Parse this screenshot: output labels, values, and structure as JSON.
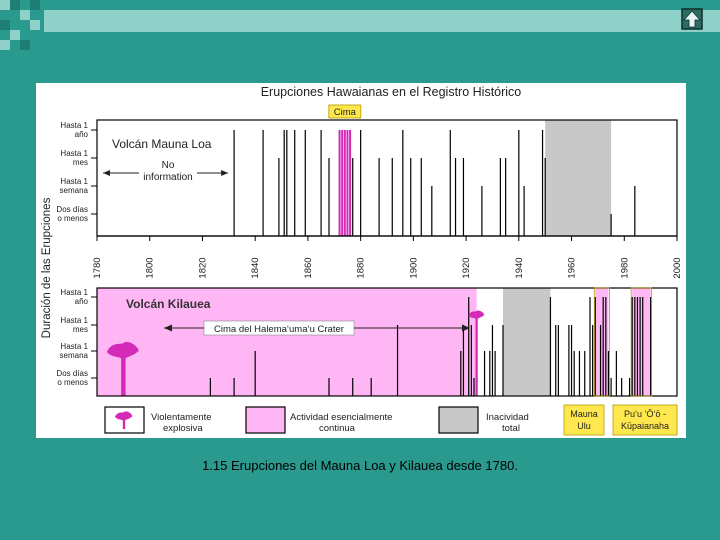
{
  "caption": "1.15  Erupciones del Mauna Loa y Kilauea desde 1780.",
  "colors": {
    "background": "#2a9a8e",
    "decor_light": "#8fd0c8",
    "decor_dark": "#1f7f75",
    "explosive": "#d42ab8",
    "continuous": "#ffb6f4",
    "inactive": "#c8c8c8",
    "event_line": "#000000"
  },
  "icons": {
    "nav": "home-arrow-icon",
    "plume": "eruption-plume-icon"
  },
  "chart_data": {
    "type": "timeline",
    "title": "Erupciones Hawaianas en el Registro Histórico",
    "ylabel": "Duración de las Erupciones",
    "xlim": [
      1780,
      2000
    ],
    "x_ticks": [
      "1780",
      "1800",
      "1820",
      "1840",
      "1860",
      "1880",
      "1900",
      "1920",
      "1940",
      "1960",
      "1980",
      "2000"
    ],
    "y_levels": [
      {
        "label": "Hasta 1 año",
        "rank": 4
      },
      {
        "label": "Hasta 1 mes",
        "rank": 3
      },
      {
        "label": "Hasta 1 semana",
        "rank": 2
      },
      {
        "label": "Dos días o menos",
        "rank": 1
      }
    ],
    "legend": [
      {
        "label": "Violentamente explosiva",
        "type": "explosive"
      },
      {
        "label": "Actividad esencialmente continua",
        "type": "continuous"
      },
      {
        "label": "Inacividad total",
        "type": "inactive"
      },
      {
        "label": "Mauna Ulu",
        "type": "marker"
      },
      {
        "label": "Pu‘u ‘Ō‘ō - Kūpaianaha",
        "type": "marker"
      }
    ],
    "panels": [
      {
        "name": "Volcán Mauna Loa",
        "annotations": [
          {
            "text": "No information",
            "x_start": 1780,
            "x_end": 1832
          },
          {
            "text": "Cima",
            "x_start": 1871,
            "x_end": 1877
          }
        ],
        "shaded": [
          {
            "type": "inactive",
            "start": 1950,
            "end": 1975
          }
        ],
        "eruptions": [
          {
            "year": 1832,
            "level": 4
          },
          {
            "year": 1843,
            "level": 4
          },
          {
            "year": 1849,
            "level": 3
          },
          {
            "year": 1851,
            "level": 4
          },
          {
            "year": 1852,
            "level": 4
          },
          {
            "year": 1855,
            "level": 4
          },
          {
            "year": 1859,
            "level": 4
          },
          {
            "year": 1865,
            "level": 4
          },
          {
            "year": 1868,
            "level": 3
          },
          {
            "year": 1872,
            "level": 4,
            "color": "explosive"
          },
          {
            "year": 1873,
            "level": 4,
            "color": "explosive"
          },
          {
            "year": 1874,
            "level": 4,
            "color": "explosive"
          },
          {
            "year": 1875,
            "level": 4,
            "color": "explosive"
          },
          {
            "year": 1876,
            "level": 4,
            "color": "explosive"
          },
          {
            "year": 1877,
            "level": 3
          },
          {
            "year": 1880,
            "level": 4
          },
          {
            "year": 1887,
            "level": 3
          },
          {
            "year": 1892,
            "level": 3
          },
          {
            "year": 1896,
            "level": 4
          },
          {
            "year": 1899,
            "level": 3
          },
          {
            "year": 1903,
            "level": 3
          },
          {
            "year": 1907,
            "level": 2
          },
          {
            "year": 1914,
            "level": 4
          },
          {
            "year": 1916,
            "level": 3
          },
          {
            "year": 1919,
            "level": 3
          },
          {
            "year": 1926,
            "level": 2
          },
          {
            "year": 1933,
            "level": 3
          },
          {
            "year": 1935,
            "level": 3
          },
          {
            "year": 1940,
            "level": 4
          },
          {
            "year": 1942,
            "level": 2
          },
          {
            "year": 1949,
            "level": 4
          },
          {
            "year": 1950,
            "level": 3
          },
          {
            "year": 1975,
            "level": 1
          },
          {
            "year": 1984,
            "level": 2
          }
        ]
      },
      {
        "name": "Volcán Kilauea",
        "annotations": [
          {
            "text": "Cima del Halema‘uma‘u Crater",
            "x_start": 1820,
            "x_end": 1924
          }
        ],
        "shaded": [
          {
            "type": "continuous",
            "start": 1780,
            "end": 1924
          },
          {
            "type": "inactive",
            "start": 1934,
            "end": 1952
          },
          {
            "type": "continuous",
            "start": 1969,
            "end": 1974
          },
          {
            "type": "continuous",
            "start": 1983,
            "end": 1990
          }
        ],
        "explosive_events": [
          1790,
          1924
        ],
        "eruptions": [
          {
            "year": 1823,
            "level": 1
          },
          {
            "year": 1832,
            "level": 1
          },
          {
            "year": 1840,
            "level": 2
          },
          {
            "year": 1868,
            "level": 1
          },
          {
            "year": 1877,
            "level": 1
          },
          {
            "year": 1884,
            "level": 1
          },
          {
            "year": 1894,
            "level": 3
          },
          {
            "year": 1918,
            "level": 2
          },
          {
            "year": 1919,
            "level": 3
          },
          {
            "year": 1921,
            "level": 4
          },
          {
            "year": 1922,
            "level": 3
          },
          {
            "year": 1923,
            "level": 1
          },
          {
            "year": 1924,
            "level": 3
          },
          {
            "year": 1927,
            "level": 2
          },
          {
            "year": 1929,
            "level": 2
          },
          {
            "year": 1930,
            "level": 3
          },
          {
            "year": 1931,
            "level": 2
          },
          {
            "year": 1934,
            "level": 3
          },
          {
            "year": 1952,
            "level": 4
          },
          {
            "year": 1954,
            "level": 3
          },
          {
            "year": 1955,
            "level": 3
          },
          {
            "year": 1959,
            "level": 3
          },
          {
            "year": 1960,
            "level": 3
          },
          {
            "year": 1961,
            "level": 2
          },
          {
            "year": 1963,
            "level": 2
          },
          {
            "year": 1965,
            "level": 2
          },
          {
            "year": 1967,
            "level": 4
          },
          {
            "year": 1968,
            "level": 3
          },
          {
            "year": 1969,
            "level": 4
          },
          {
            "year": 1971,
            "level": 3
          },
          {
            "year": 1972,
            "level": 4
          },
          {
            "year": 1973,
            "level": 4
          },
          {
            "year": 1974,
            "level": 2
          },
          {
            "year": 1975,
            "level": 1
          },
          {
            "year": 1977,
            "level": 2
          },
          {
            "year": 1979,
            "level": 1
          },
          {
            "year": 1982,
            "level": 1
          },
          {
            "year": 1983,
            "level": 4
          },
          {
            "year": 1984,
            "level": 4
          },
          {
            "year": 1985,
            "level": 4
          },
          {
            "year": 1986,
            "level": 4
          },
          {
            "year": 1987,
            "level": 4
          },
          {
            "year": 1990,
            "level": 4
          }
        ]
      }
    ]
  }
}
